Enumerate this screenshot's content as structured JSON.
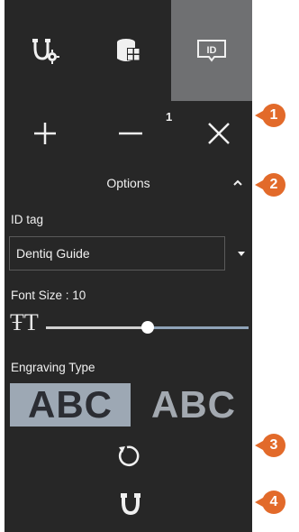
{
  "tabs": [
    {
      "name": "tooth-settings-tab",
      "icon": "tooth-gear-icon",
      "active": false
    },
    {
      "name": "model-tab",
      "icon": "cube-grid-icon",
      "active": false
    },
    {
      "name": "id-tag-tab",
      "icon": "id-label-icon",
      "active": true,
      "label": "ID"
    }
  ],
  "toolbar": {
    "add": "+",
    "remove": "—",
    "close": "✕",
    "count": "1"
  },
  "options": {
    "label": "Options",
    "expanded": true
  },
  "id_tag": {
    "label": "ID tag",
    "value": "Dentiq  Guide"
  },
  "font_size": {
    "label": "Font Size : 10",
    "value": 10,
    "slider_fraction": 0.5
  },
  "engraving": {
    "label": "Engraving Type",
    "options": [
      "ABC",
      "ABC"
    ],
    "selected": 0
  },
  "callouts": [
    "1",
    "2",
    "3",
    "4"
  ],
  "colors": {
    "panel": "#272727",
    "active_tab": "#6f7072",
    "accent": "#e26a2a",
    "selected_abc_bg": "#9da8b4"
  }
}
